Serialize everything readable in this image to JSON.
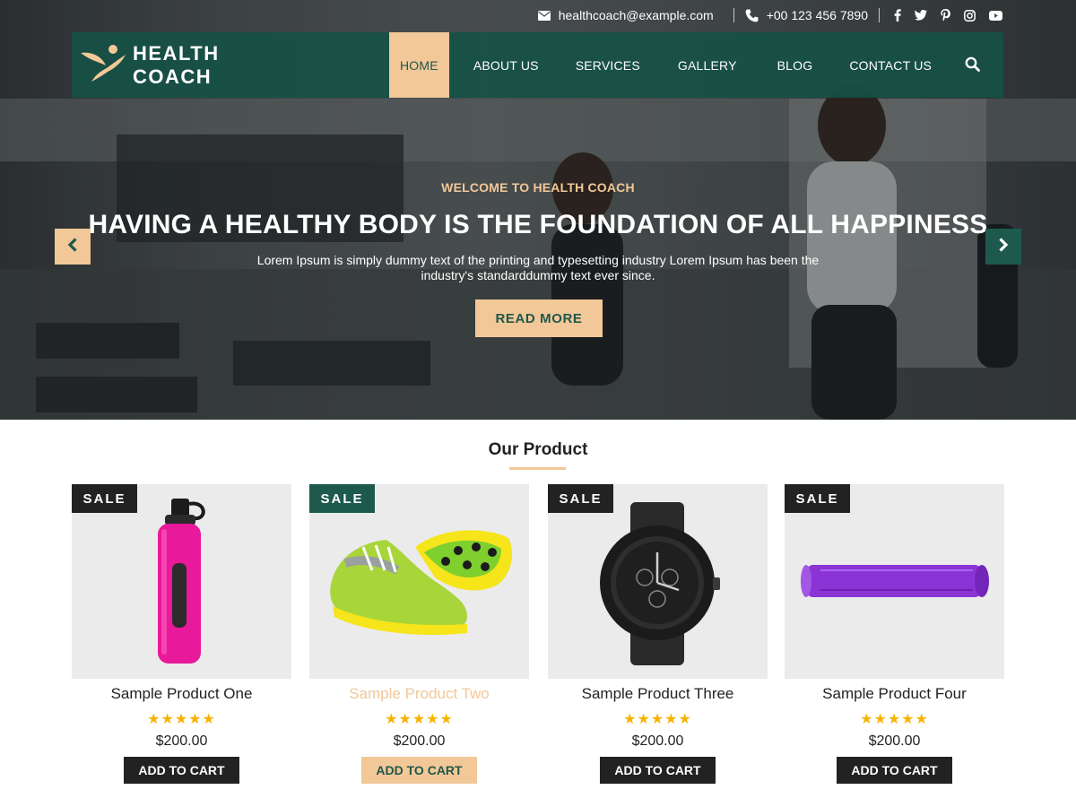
{
  "colors": {
    "brand_green": "#1d5a4d",
    "accent_peach": "#f2c898",
    "dark": "#222222",
    "star_gold": "#f5b400"
  },
  "topbar": {
    "email": "healthcoach@example.com",
    "phone": "+00 123 456 7890",
    "email_icon": "envelope-icon",
    "phone_icon": "phone-icon",
    "social_icons": [
      "facebook-icon",
      "twitter-icon",
      "pinterest-icon",
      "instagram-icon",
      "youtube-icon"
    ]
  },
  "logo": {
    "line1": "HEALTH",
    "line2": "COACH"
  },
  "nav": {
    "items": [
      "HOME",
      "ABOUT US",
      "SERVICES",
      "GALLERY",
      "BLOG",
      "CONTACT US"
    ],
    "active": "HOME",
    "search_icon": "search-icon"
  },
  "hero": {
    "kicker": "WELCOME TO HEALTH COACH",
    "headline": "HAVING A HEALTHY BODY IS THE FOUNDATION OF ALL HAPPINESS",
    "subtext": "Lorem Ipsum is simply dummy text of the printing and typesetting industry Lorem Ipsum has been the industry's standarddummy text ever since.",
    "button": "READ MORE",
    "prev_icon": "chevron-left-icon",
    "next_icon": "chevron-right-icon"
  },
  "products": {
    "title": "Our Product",
    "items": [
      {
        "name": "Sample Product One",
        "badge": "SALE",
        "price": "$200.00",
        "rating": "★★★★★",
        "cart": "ADD TO CART",
        "image": "pink-water-bottle"
      },
      {
        "name": "Sample Product Two",
        "badge": "SALE",
        "price": "$200.00",
        "rating": "★★★★★",
        "cart": "ADD TO CART",
        "image": "green-running-shoe"
      },
      {
        "name": "Sample Product Three",
        "badge": "SALE",
        "price": "$200.00",
        "rating": "★★★★★",
        "cart": "ADD TO CART",
        "image": "black-wrist-watch"
      },
      {
        "name": "Sample Product Four",
        "badge": "SALE",
        "price": "$200.00",
        "rating": "★★★★★",
        "cart": "ADD TO CART",
        "image": "purple-yoga-mat"
      }
    ]
  }
}
